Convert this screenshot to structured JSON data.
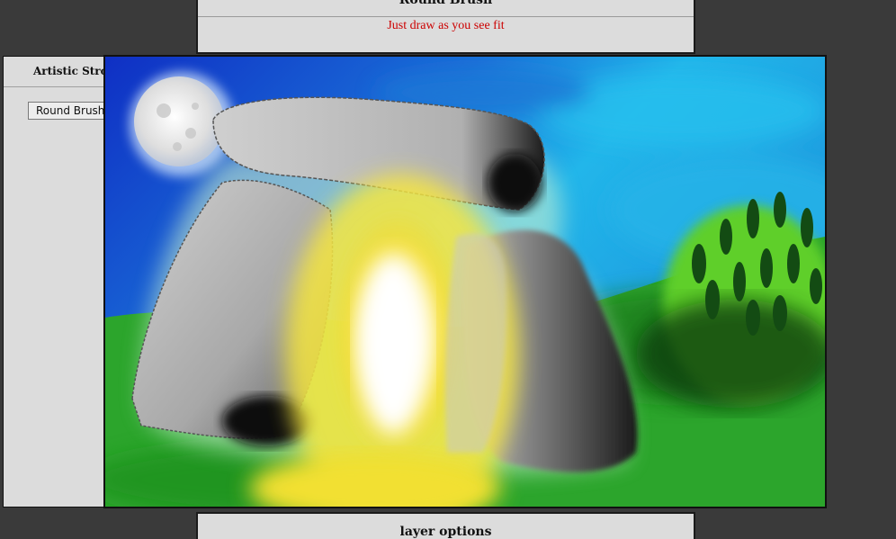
{
  "brush_panel": {
    "title": "Round Brush",
    "hint": "Just draw as you see fit",
    "hint_color": "#cc0000"
  },
  "stroke_panel": {
    "title": "Artistic Stroke",
    "brush_button_label": "Round Brush"
  },
  "layer_panel": {
    "title": "layer options"
  },
  "canvas": {
    "scene": "painted dolmen with glowing portal, moon, sky and trees",
    "colors": {
      "sky_deep": "#1030c0",
      "sky_light": "#20b8e8",
      "grass": "#2aa22a",
      "stone": "#b8b8b8",
      "glow": "#ffe84a",
      "moon": "#f0f0f0"
    }
  }
}
